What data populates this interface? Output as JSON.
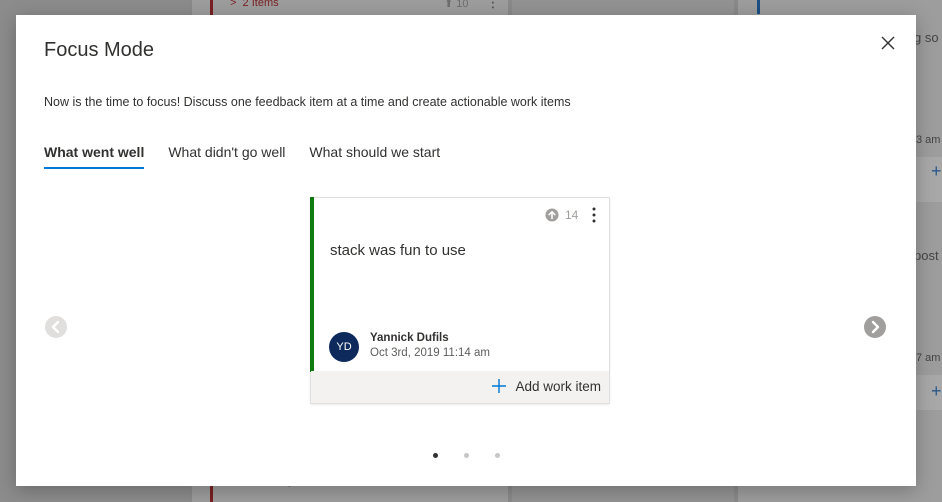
{
  "background": {
    "items_label": "2 Items",
    "votes_label": "10",
    "fragment_1": "g so",
    "fragment_2": "3 am",
    "fragment_3": "post",
    "fragment_4": "7 am",
    "fragment_5": "y"
  },
  "modal": {
    "title": "Focus Mode",
    "subtitle": "Now is the time to focus! Discuss one feedback item at a time and create actionable work items",
    "tabs": [
      {
        "label": "What went well",
        "active": true
      },
      {
        "label": "What didn't go well",
        "active": false
      },
      {
        "label": "What should we start",
        "active": false
      }
    ]
  },
  "card": {
    "votes": "14",
    "text": "stack was fun to use",
    "avatar_initials": "YD",
    "author": "Yannick Dufils",
    "date": "Oct 3rd, 2019 11:14 am",
    "add_work_item_label": "Add work item",
    "accent_color": "#107c10"
  },
  "carousel": {
    "page_count": 3,
    "active_page": 1
  },
  "colors": {
    "accent": "#0078d4",
    "avatar_bg": "#0e2a5c"
  },
  "icons": {
    "close": "close-icon",
    "prev": "chevron-left-circle-icon",
    "next": "chevron-right-circle-icon",
    "upvote": "arrow-up-circle-icon",
    "more": "more-vertical-icon",
    "add": "plus-icon"
  }
}
